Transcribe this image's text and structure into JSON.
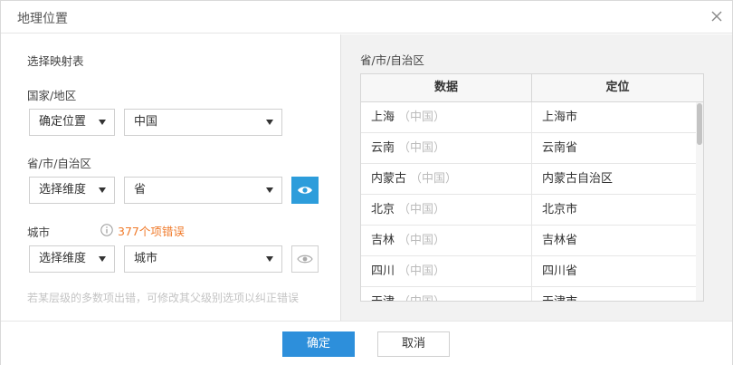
{
  "dialog": {
    "title": "地理位置",
    "close_icon": "close-icon"
  },
  "left": {
    "mapping_label": "选择映射表",
    "country": {
      "label": "国家/地区",
      "mode": "确定位置",
      "value": "中国"
    },
    "province": {
      "label": "省/市/自治区",
      "mode": "选择维度",
      "value": "省",
      "eye_active": true
    },
    "city": {
      "label": "城市",
      "error_text": "377个项错误",
      "mode": "选择维度",
      "value": "城市",
      "eye_active": false
    },
    "hint": "若某层级的多数项出错，可修改其父级别选项以纠正错误"
  },
  "right": {
    "title": "省/市/自治区",
    "columns": [
      "数据",
      "定位"
    ],
    "rows": [
      {
        "data": "上海",
        "note": "（中国）",
        "location": "上海市"
      },
      {
        "data": "云南",
        "note": "（中国）",
        "location": "云南省"
      },
      {
        "data": "内蒙古",
        "note": "（中国）",
        "location": "内蒙古自治区"
      },
      {
        "data": "北京",
        "note": "（中国）",
        "location": "北京市"
      },
      {
        "data": "吉林",
        "note": "（中国）",
        "location": "吉林省"
      },
      {
        "data": "四川",
        "note": "（中国）",
        "location": "四川省"
      },
      {
        "data": "天津",
        "note": "（中国）",
        "location": "天津市"
      }
    ]
  },
  "footer": {
    "ok_label": "确定",
    "cancel_label": "取消"
  },
  "colors": {
    "primary": "#2d8fdb",
    "eye_active": "#2d9ddb",
    "error": "#f07b2c",
    "hint": "#c4c4c4"
  }
}
